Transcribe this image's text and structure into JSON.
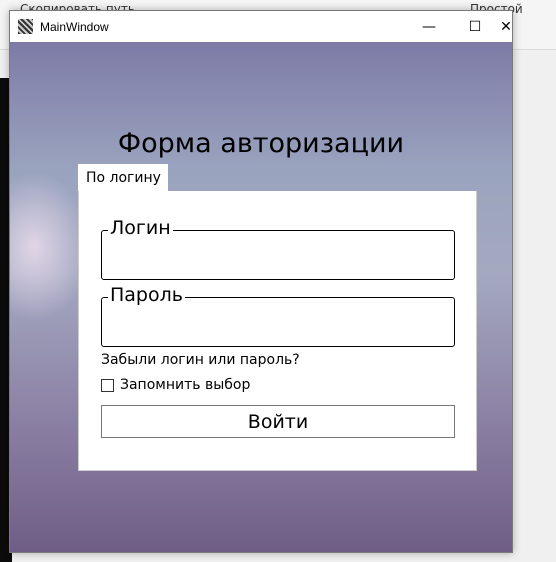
{
  "background": {
    "toolbar_text": "Скопировать путь",
    "right_text": "Простой"
  },
  "window": {
    "title": "MainWindow",
    "minimize": "—",
    "maximize": "☐",
    "close": "✕"
  },
  "form": {
    "heading": "Форма авторизации",
    "tab": "По логину",
    "login_label": "Логин",
    "login_value": "",
    "password_label": "Пароль",
    "password_value": "",
    "forgot": "Забыли логин или пароль?",
    "remember": "Запомнить выбор",
    "remember_checked": false,
    "submit": "Войти"
  }
}
